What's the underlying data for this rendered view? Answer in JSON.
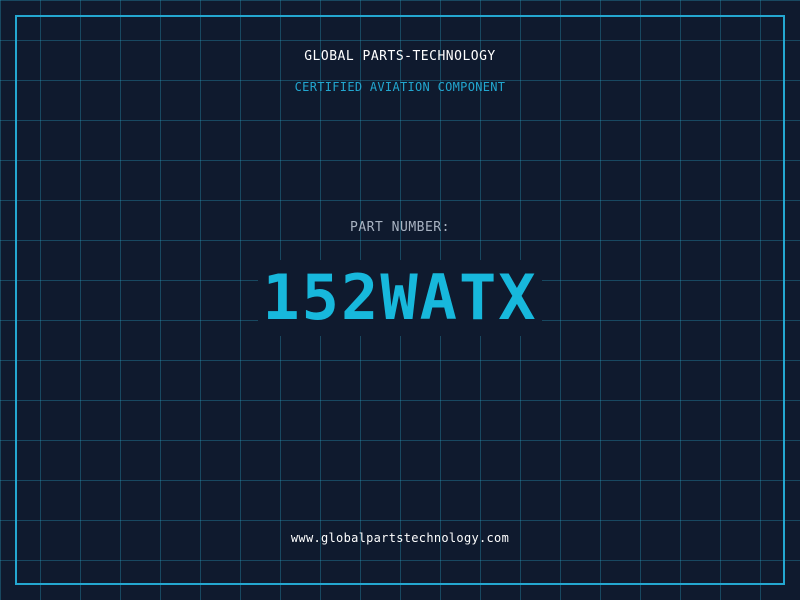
{
  "header": {
    "company": "GLOBAL PARTS-TECHNOLOGY",
    "tagline": "CERTIFIED AVIATION COMPONENT"
  },
  "part": {
    "label": "PART NUMBER:",
    "number": "152WATX"
  },
  "footer": {
    "website": "www.globalpartstechnology.com"
  },
  "colors": {
    "background": "#0f1a2e",
    "accent": "#17b8dc",
    "frame": "#24a7d0",
    "grid": "#2aa8cc",
    "label": "#a9b3c2",
    "text": "#ffffff"
  }
}
